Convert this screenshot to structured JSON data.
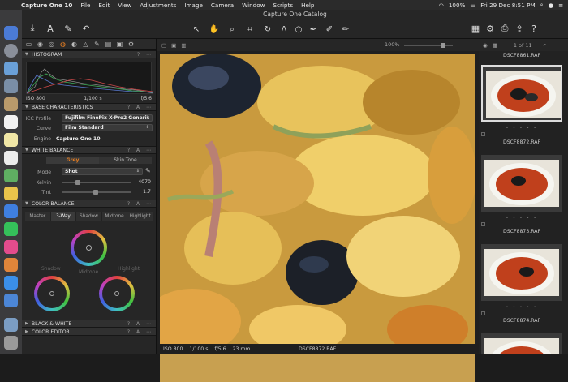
{
  "menubar": {
    "app_name": "Capture One 10",
    "items": [
      "File",
      "Edit",
      "View",
      "Adjustments",
      "Image",
      "Camera",
      "Window",
      "Scripts",
      "Help"
    ],
    "battery": "100%",
    "datetime": "Fri 29 Dec  8:51 PM"
  },
  "window": {
    "title": "Capture One Catalog"
  },
  "left_panel": {
    "histogram": {
      "title": "HISTOGRAM",
      "iso": "ISO 800",
      "shutter": "1/100 s",
      "aperture": "f/5.6"
    },
    "base_characteristics": {
      "title": "BASE CHARACTERISTICS",
      "icc_label": "ICC Profile",
      "icc_value": "Fujifilm FinePix X-Pro2 Generic",
      "curve_label": "Curve",
      "curve_value": "Film Standard",
      "engine_label": "Engine",
      "engine_value": "Capture One 10"
    },
    "white_balance": {
      "title": "WHITE BALANCE",
      "tab_grey": "Grey",
      "tab_skin": "Skin Tone",
      "mode_label": "Mode",
      "mode_value": "Shot",
      "kelvin_label": "Kelvin",
      "kelvin_value": "4070",
      "tint_label": "Tint",
      "tint_value": "1.7"
    },
    "color_balance": {
      "title": "COLOR BALANCE",
      "tabs": [
        "Master",
        "3-Way",
        "Shadow",
        "Midtone",
        "Highlight"
      ],
      "active_tab": "3-Way",
      "wheel_shadow": "Shadow",
      "wheel_midtone": "Midtone",
      "wheel_highlight": "Highlight"
    },
    "black_white": {
      "title": "BLACK & WHITE"
    },
    "color_editor": {
      "title": "COLOR EDITOR"
    }
  },
  "viewer": {
    "zoom": "100%",
    "page_counter": "1 of 11",
    "iso": "ISO 800",
    "shutter": "1/100 s",
    "aperture": "f/5.6",
    "focal": "23 mm",
    "filename": "DSCF8872.RAF"
  },
  "browser": {
    "top_name": "DSCF8861.RAF",
    "thumbs": [
      {
        "name": "DSCF8872.RAF"
      },
      {
        "name": "DSCF8873.RAF"
      },
      {
        "name": "DSCF8874.RAF"
      }
    ]
  },
  "colors": {
    "accent": "#e67e22",
    "panel": "#262626",
    "background": "#1c1c1c"
  }
}
